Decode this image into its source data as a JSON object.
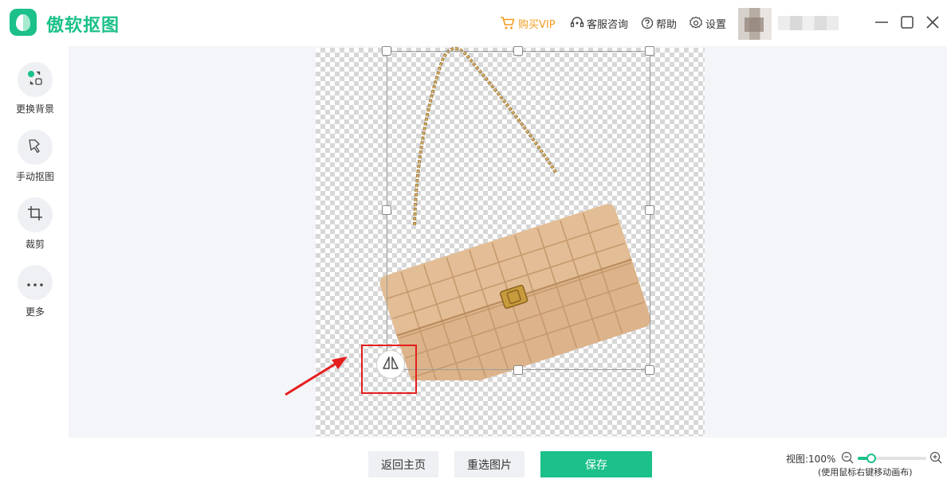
{
  "app": {
    "name": "傲软抠图",
    "brand_color": "#1cc08a"
  },
  "header": {
    "buy_vip": "购买VIP",
    "customer_service": "客服咨询",
    "help": "帮助",
    "settings": "设置"
  },
  "sidebar": {
    "items": [
      {
        "label": "更换背景",
        "icon": "swap-background-icon"
      },
      {
        "label": "手动抠图",
        "icon": "manual-cutout-icon"
      },
      {
        "label": "裁剪",
        "icon": "crop-icon"
      },
      {
        "label": "更多",
        "icon": "more-dots-icon"
      }
    ]
  },
  "bottom": {
    "back_home": "返回主页",
    "reselect_image": "重选图片",
    "save": "保存",
    "zoom_label": "视图:100%",
    "zoom_hint": "(使用鼠标右键移动画布)",
    "zoom_level_fraction": 0.2
  },
  "annotation": {
    "highlight_color": "#e61e1e"
  }
}
